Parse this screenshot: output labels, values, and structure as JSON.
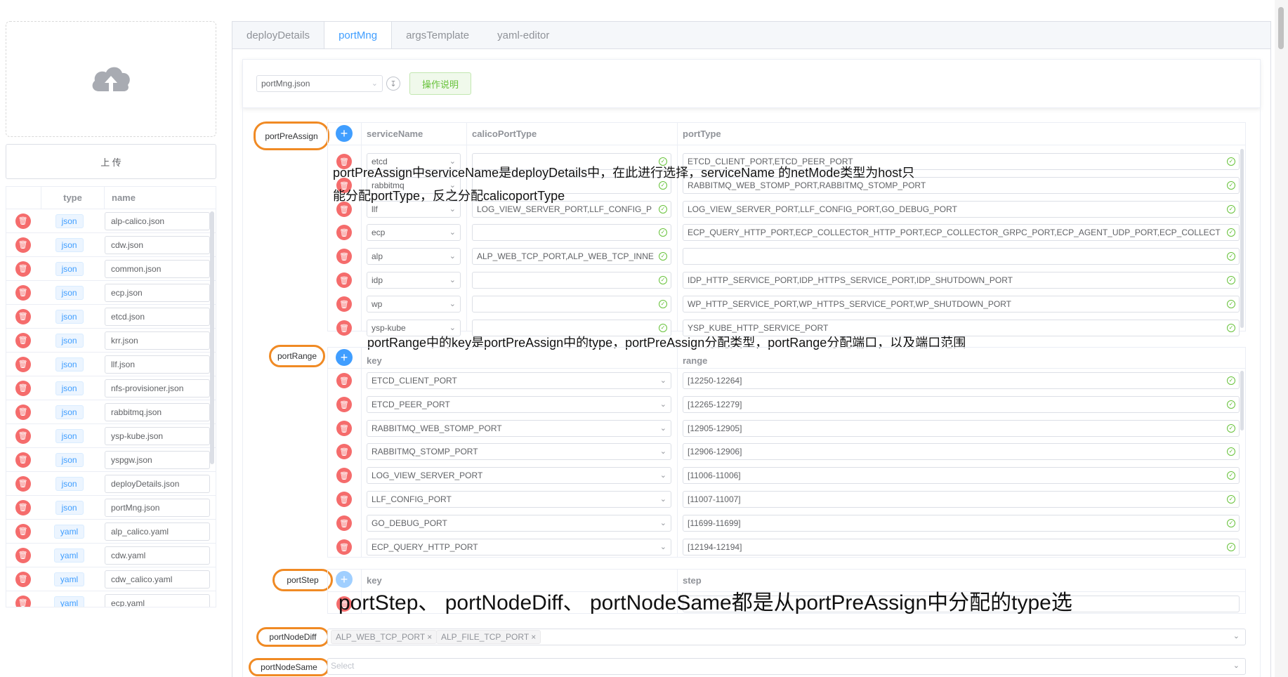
{
  "left_panel": {
    "upload_button_label": "上 传",
    "table_headers": {
      "type": "type",
      "name": "name"
    },
    "files": [
      {
        "type": "json",
        "name": "alp-calico.json"
      },
      {
        "type": "json",
        "name": "cdw.json"
      },
      {
        "type": "json",
        "name": "common.json"
      },
      {
        "type": "json",
        "name": "ecp.json"
      },
      {
        "type": "json",
        "name": "etcd.json"
      },
      {
        "type": "json",
        "name": "krr.json"
      },
      {
        "type": "json",
        "name": "llf.json"
      },
      {
        "type": "json",
        "name": "nfs-provisioner.json"
      },
      {
        "type": "json",
        "name": "rabbitmq.json"
      },
      {
        "type": "json",
        "name": "ysp-kube.json"
      },
      {
        "type": "json",
        "name": "yspgw.json"
      },
      {
        "type": "json",
        "name": "deployDetails.json"
      },
      {
        "type": "json",
        "name": "portMng.json"
      },
      {
        "type": "yaml",
        "name": "alp_calico.yaml"
      },
      {
        "type": "yaml",
        "name": "cdw.yaml"
      },
      {
        "type": "yaml",
        "name": "cdw_calico.yaml"
      },
      {
        "type": "yaml",
        "name": "ecp.yaml"
      }
    ]
  },
  "tabs": [
    {
      "label": "deployDetails",
      "active": false
    },
    {
      "label": "portMng",
      "active": true
    },
    {
      "label": "argsTemplate",
      "active": false
    },
    {
      "label": "yaml-editor",
      "active": false
    }
  ],
  "toolbar": {
    "file_select": "portMng.json",
    "op_button": "操作说明"
  },
  "portPreAssign": {
    "label": "portPreAssign",
    "headers": {
      "serviceName": "serviceName",
      "calicoPortType": "calicoPortType",
      "portType": "portType"
    },
    "rows": [
      {
        "serviceName": "etcd",
        "calicoPortType": "",
        "portType": "ETCD_CLIENT_PORT,ETCD_PEER_PORT"
      },
      {
        "serviceName": "rabbitmq",
        "calicoPortType": "",
        "portType": "RABBITMQ_WEB_STOMP_PORT,RABBITMQ_STOMP_PORT"
      },
      {
        "serviceName": "llf",
        "calicoPortType": "LOG_VIEW_SERVER_PORT,LLF_CONFIG_P",
        "portType": "LOG_VIEW_SERVER_PORT,LLF_CONFIG_PORT,GO_DEBUG_PORT"
      },
      {
        "serviceName": "ecp",
        "calicoPortType": "",
        "portType": "ECP_QUERY_HTTP_PORT,ECP_COLLECTOR_HTTP_PORT,ECP_COLLECTOR_GRPC_PORT,ECP_AGENT_UDP_PORT,ECP_COLLECT"
      },
      {
        "serviceName": "alp",
        "calicoPortType": "ALP_WEB_TCP_PORT,ALP_WEB_TCP_INNE",
        "portType": ""
      },
      {
        "serviceName": "idp",
        "calicoPortType": "",
        "portType": "IDP_HTTP_SERVICE_PORT,IDP_HTTPS_SERVICE_PORT,IDP_SHUTDOWN_PORT"
      },
      {
        "serviceName": "wp",
        "calicoPortType": "",
        "portType": "WP_HTTP_SERVICE_PORT,WP_HTTPS_SERVICE_PORT,WP_SHUTDOWN_PORT"
      },
      {
        "serviceName": "ysp-kube",
        "calicoPortType": "",
        "portType": "YSP_KUBE_HTTP_SERVICE_PORT"
      }
    ],
    "annotation_line1": "portPreAssign中serviceName是deployDetails中，在此进行选择，serviceName 的netMode类型为host只",
    "annotation_line2": "能分配portType，反之分配calicoportType"
  },
  "portRange": {
    "label": "portRange",
    "headers": {
      "key": "key",
      "range": "range"
    },
    "annotation": "portRange中的key是portPreAssign中的type，portPreAssign分配类型，portRange分配端口，以及端口范围",
    "rows": [
      {
        "key": "ETCD_CLIENT_PORT",
        "range": "[12250-12264]"
      },
      {
        "key": "ETCD_PEER_PORT",
        "range": "[12265-12279]"
      },
      {
        "key": "RABBITMQ_WEB_STOMP_PORT",
        "range": "[12905-12905]"
      },
      {
        "key": "RABBITMQ_STOMP_PORT",
        "range": "[12906-12906]"
      },
      {
        "key": "LOG_VIEW_SERVER_PORT",
        "range": "[11006-11006]"
      },
      {
        "key": "LLF_CONFIG_PORT",
        "range": "[11007-11007]"
      },
      {
        "key": "GO_DEBUG_PORT",
        "range": "[11699-11699]"
      },
      {
        "key": "ECP_QUERY_HTTP_PORT",
        "range": "[12194-12194]"
      }
    ]
  },
  "portStep": {
    "label": "portStep",
    "headers": {
      "key": "key",
      "step": "step"
    },
    "annotation": "portStep、 portNodeDiff、 portNodeSame都是从portPreAssign中分配的type选"
  },
  "portNodeDiff": {
    "label": "portNodeDiff",
    "chips": [
      "ALP_WEB_TCP_PORT",
      "ALP_FILE_TCP_PORT"
    ]
  },
  "portNodeSame": {
    "label": "portNodeSame",
    "placeholder": "Select"
  },
  "colors": {
    "primary": "#409eff",
    "danger": "#f56c6c",
    "success": "#67c23a",
    "highlight": "#f08a24"
  }
}
